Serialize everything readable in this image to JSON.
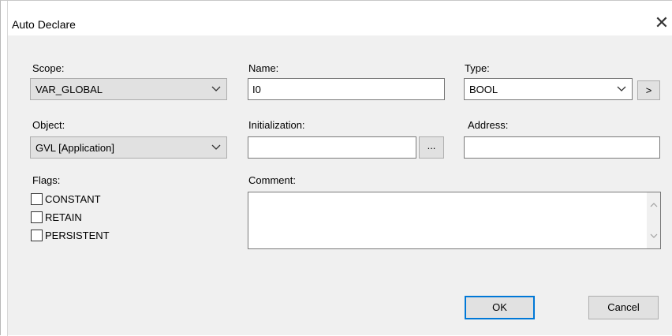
{
  "window": {
    "title": "Auto Declare"
  },
  "icons": {
    "close": "close-icon",
    "dropdown": "chevron-down-icon"
  },
  "scope": {
    "label": "Scope:",
    "value": "VAR_GLOBAL"
  },
  "name": {
    "label": "Name:",
    "value": "I0"
  },
  "type": {
    "label": "Type:",
    "value": "BOOL",
    "browse_label": ">"
  },
  "object": {
    "label": "Object:",
    "value": "GVL [Application]"
  },
  "initialization": {
    "label": "Initialization:",
    "value": "",
    "browse_label": "..."
  },
  "address": {
    "label": "Address:",
    "value": ""
  },
  "flags": {
    "label": "Flags:",
    "items": [
      {
        "label": "CONSTANT",
        "checked": false
      },
      {
        "label": "RETAIN",
        "checked": false
      },
      {
        "label": "PERSISTENT",
        "checked": false
      }
    ]
  },
  "comment": {
    "label": "Comment:",
    "value": ""
  },
  "buttons": {
    "ok": "OK",
    "cancel": "Cancel"
  },
  "colors": {
    "accent": "#0078d7",
    "dialog_bg": "#f0f0f0"
  }
}
